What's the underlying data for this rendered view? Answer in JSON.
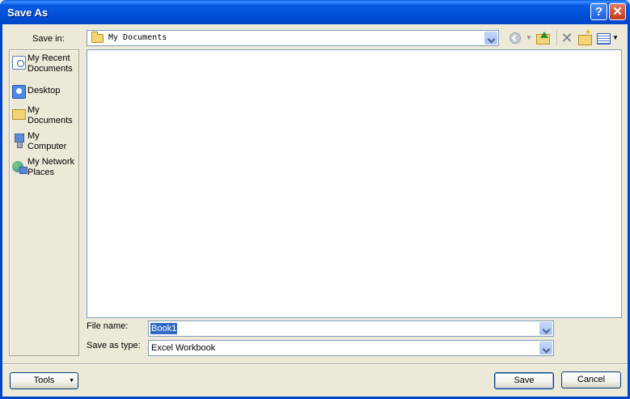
{
  "window": {
    "title": "Save As",
    "help_glyph": "?",
    "close_glyph": "✕"
  },
  "toolbar": {
    "save_in_label": "Save in:",
    "save_in_value": "My Documents",
    "delete_glyph": "✕",
    "dropdown_glyph": "▼"
  },
  "places": [
    {
      "label": "My Recent Documents",
      "icon": "recent-documents-icon"
    },
    {
      "label": "Desktop",
      "icon": "desktop-icon"
    },
    {
      "label": "My Documents",
      "icon": "my-documents-icon"
    },
    {
      "label": "My Computer",
      "icon": "my-computer-icon"
    },
    {
      "label": "My Network Places",
      "icon": "network-places-icon"
    }
  ],
  "form": {
    "file_name_label": "File name:",
    "file_name_value": "Book1",
    "save_as_type_label": "Save as type:",
    "save_as_type_value": "Excel Workbook"
  },
  "buttons": {
    "tools": "Tools",
    "save": "Save",
    "cancel": "Cancel"
  }
}
